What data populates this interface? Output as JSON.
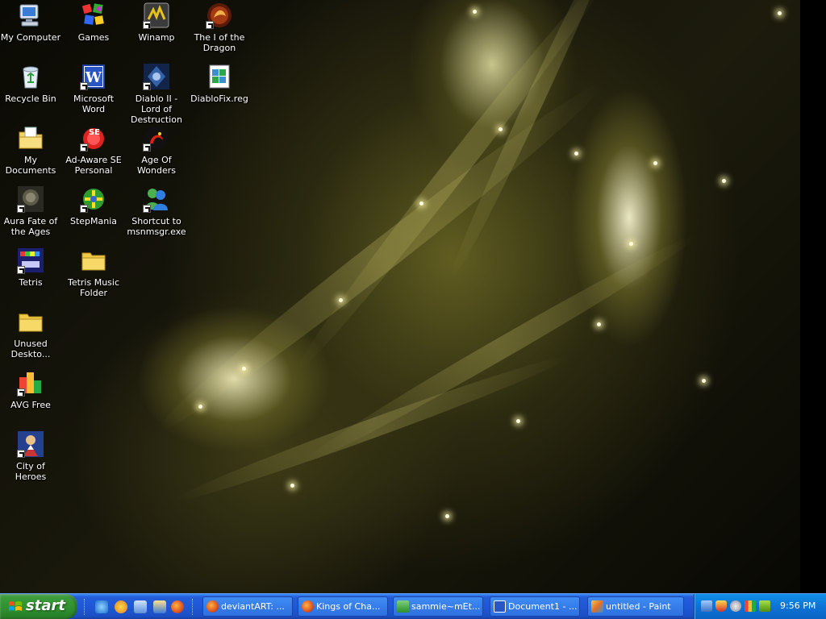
{
  "desktop": {
    "icons": [
      {
        "label": "My Computer",
        "icon": "my-computer-icon"
      },
      {
        "label": "Games",
        "icon": "games-icon"
      },
      {
        "label": "Winamp",
        "icon": "winamp-icon"
      },
      {
        "label": "The I of the Dragon",
        "icon": "dragon-game-icon"
      },
      {
        "label": "Recycle Bin",
        "icon": "recycle-bin-icon"
      },
      {
        "label": "Microsoft Word",
        "icon": "microsoft-word-icon"
      },
      {
        "label": "Diablo II - Lord of Destruction",
        "icon": "diablo-icon"
      },
      {
        "label": "DiabloFix.reg",
        "icon": "registry-file-icon"
      },
      {
        "label": "My Documents",
        "icon": "my-documents-icon"
      },
      {
        "label": "Ad-Aware SE Personal",
        "icon": "ad-aware-icon"
      },
      {
        "label": "Age Of Wonders",
        "icon": "age-of-wonders-icon"
      },
      {
        "label": "Aura Fate of the Ages",
        "icon": "aura-game-icon"
      },
      {
        "label": "StepMania",
        "icon": "stepmania-icon"
      },
      {
        "label": "Shortcut to msnmsgr.exe",
        "icon": "msn-messenger-icon"
      },
      {
        "label": "Tetris",
        "icon": "tetris-icon"
      },
      {
        "label": "Tetris Music Folder",
        "icon": "folder-icon"
      },
      {
        "label": "Unused Deskto...",
        "icon": "folder-icon"
      },
      {
        "label": "AVG Free",
        "icon": "avg-icon"
      },
      {
        "label": "City of Heroes",
        "icon": "city-of-heroes-icon"
      }
    ]
  },
  "taskbar": {
    "start_label": "start",
    "quick_launch": [
      "internet-explorer-icon",
      "media-player-icon",
      "show-desktop-icon",
      "outlook-icon",
      "firefox-icon"
    ],
    "tasks": [
      {
        "label": "deviantART: ...",
        "icon": "firefox-icon"
      },
      {
        "label": "Kings of Cha...",
        "icon": "firefox-icon"
      },
      {
        "label": "sammie~mEt...",
        "icon": "chat-window-icon"
      },
      {
        "label": "Document1 - ...",
        "icon": "microsoft-word-icon"
      },
      {
        "label": "untitled - Paint",
        "icon": "paint-icon"
      }
    ],
    "tray_icons": [
      "network-icon",
      "security-shield-icon",
      "speaker-icon",
      "avg-tray-icon",
      "nvidia-icon"
    ],
    "clock": "9:56 PM"
  },
  "colors": {
    "taskbar_blue": "#245edb",
    "start_green": "#389a38",
    "tray_blue": "#0c73d6"
  }
}
